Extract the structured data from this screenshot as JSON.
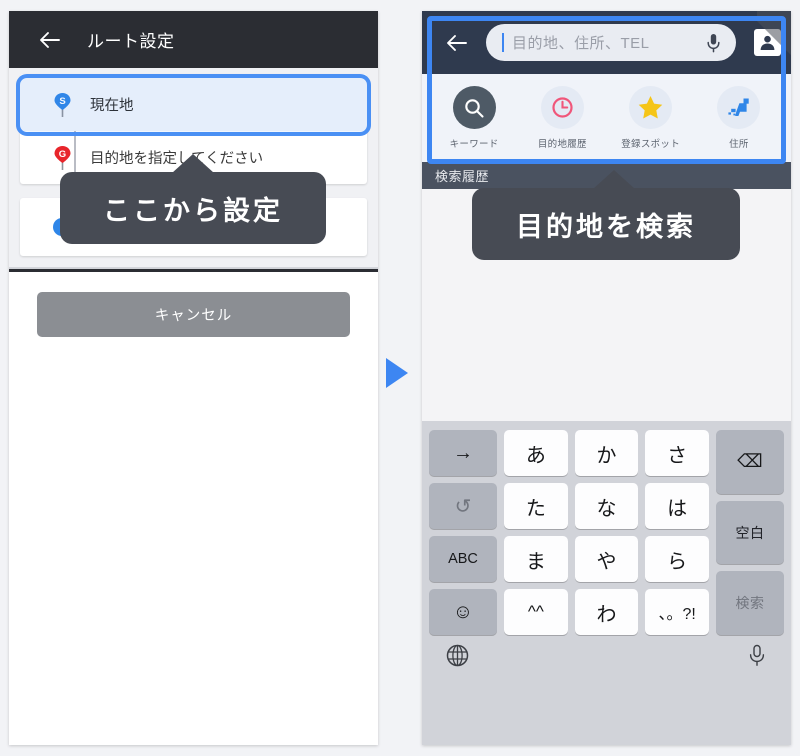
{
  "left_panel": {
    "header": {
      "title": "ルート設定",
      "back_icon": "back-arrow-icon"
    },
    "route": {
      "origin": {
        "marker": "S",
        "label": "現在地"
      },
      "destination": {
        "marker": "G",
        "label": "目的地を指定してください"
      }
    },
    "time_card": {
      "icon": "clock-icon",
      "label": ""
    },
    "cancel_label": "キャンセル",
    "callout": "ここから設定"
  },
  "right_panel": {
    "search": {
      "back_icon": "back-arrow-icon",
      "placeholder": "目的地、住所、TEL",
      "value": "",
      "mic_icon": "microphone-icon",
      "profile_icon": "profile-icon"
    },
    "quick_actions": [
      {
        "label": "キーワード",
        "icon": "search-icon",
        "style": "dark"
      },
      {
        "label": "目的地履歴",
        "icon": "clock-icon",
        "style": "light"
      },
      {
        "label": "登録スポット",
        "icon": "star-icon",
        "style": "light"
      },
      {
        "label": "住所",
        "icon": "japan-map-icon",
        "style": "light"
      }
    ],
    "history_bar": "検索履歴",
    "callout": "目的地を検索",
    "keyboard": {
      "left_column": [
        "→",
        "↺",
        "ABC",
        "☺"
      ],
      "middle_rows": [
        [
          "あ",
          "か",
          "さ"
        ],
        [
          "た",
          "な",
          "は"
        ],
        [
          "ま",
          "や",
          "ら"
        ],
        [
          "^^",
          "わ",
          "、。?!"
        ]
      ],
      "right_column": [
        "⌫",
        "空白",
        "検索"
      ],
      "globe_icon": "globe-icon",
      "mic_icon": "microphone-icon"
    }
  },
  "center_arrow_icon": "play-triangle-icon",
  "colors": {
    "accent_blue": "#3d86f2",
    "header_dark": "#2b2d33",
    "search_header": "#2f3a4e",
    "callout_bg": "#474b54",
    "pin_start": "#2f86e8",
    "pin_goal": "#e8252b",
    "star_yellow": "#f5c518",
    "cancel_gray": "#8b8e93"
  }
}
